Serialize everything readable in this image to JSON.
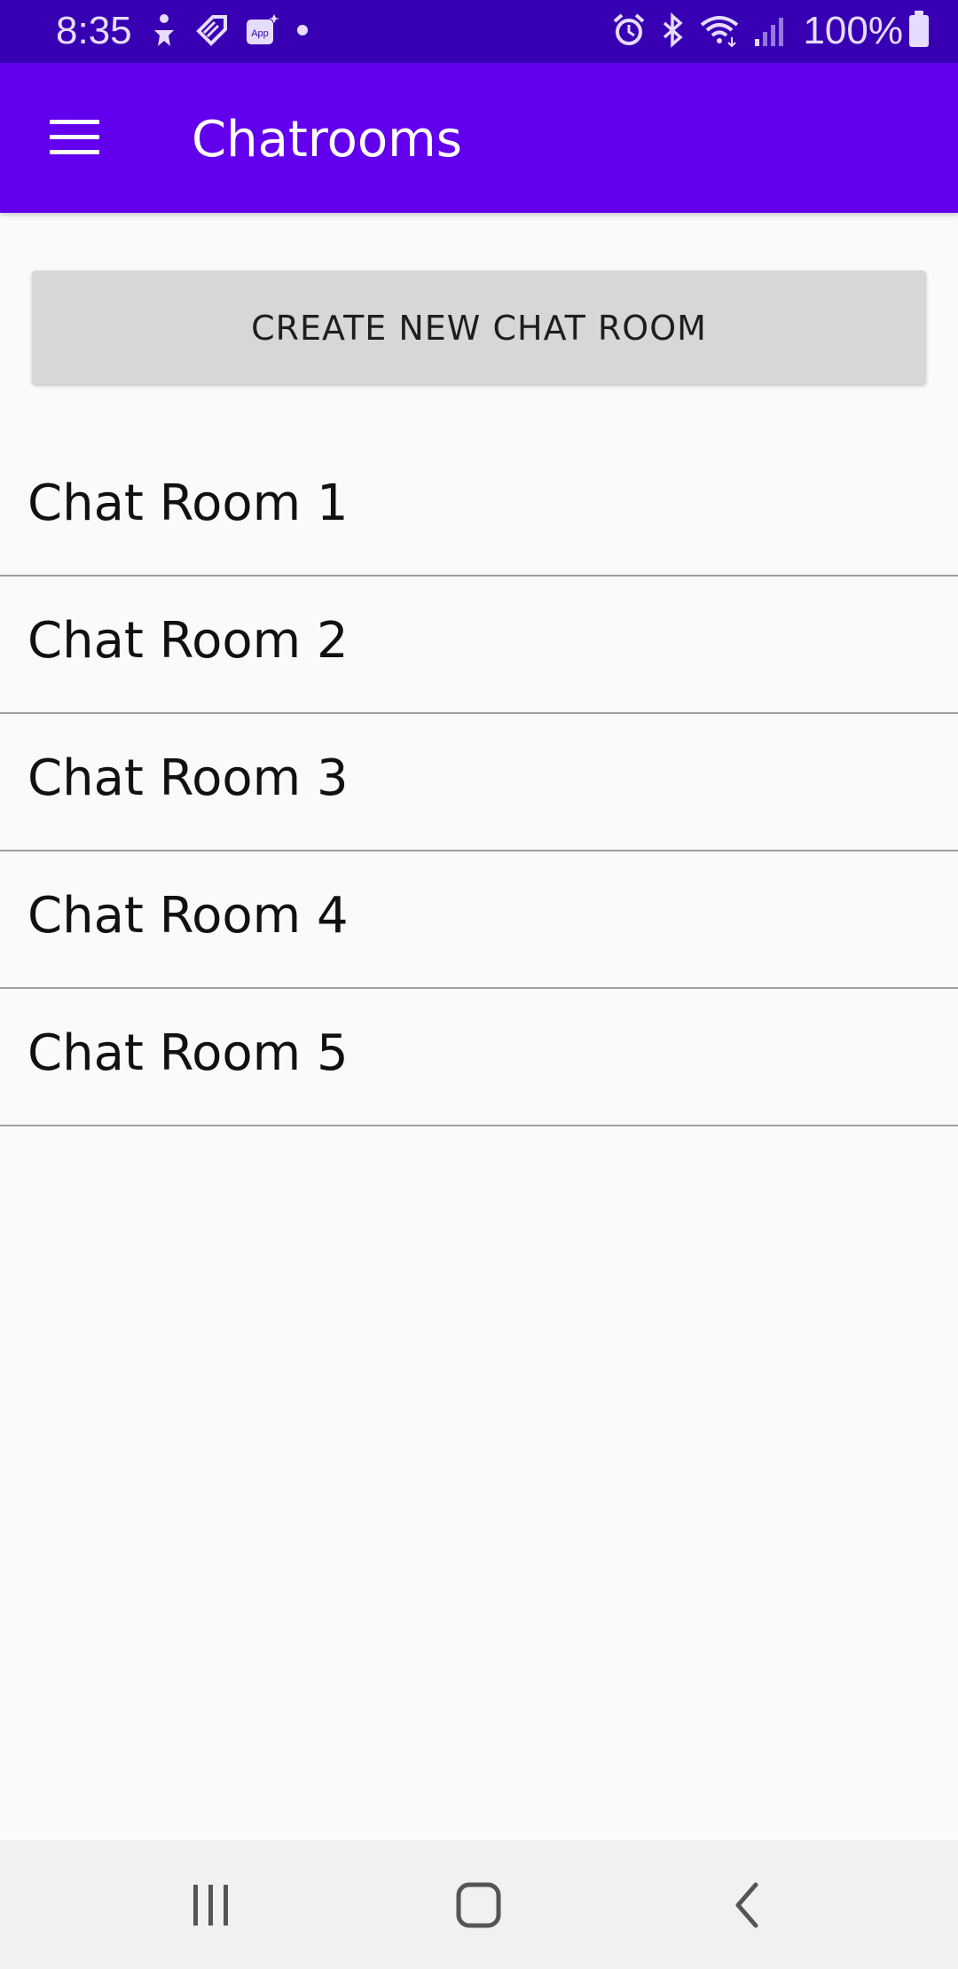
{
  "status_bar": {
    "time": "8:35",
    "battery": "100%",
    "left_icons": [
      "accessibility-icon",
      "tag-icon",
      "app-notification-icon",
      "dot-icon"
    ],
    "right_icons": [
      "alarm-icon",
      "bluetooth-icon",
      "wifi-icon",
      "signal-icon",
      "battery-icon"
    ]
  },
  "app_bar": {
    "title": "Chatrooms",
    "menu_icon": "menu-icon"
  },
  "create_button": {
    "label": "CREATE NEW CHAT ROOM"
  },
  "rooms": [
    {
      "name": "Chat Room 1"
    },
    {
      "name": "Chat Room 2"
    },
    {
      "name": "Chat Room 3"
    },
    {
      "name": "Chat Room 4"
    },
    {
      "name": "Chat Room 5"
    }
  ],
  "nav_bar": {
    "buttons": [
      "recents-icon",
      "home-icon",
      "back-icon"
    ]
  },
  "colors": {
    "status_bar": "#3700b3",
    "app_bar": "#6200ee",
    "background": "#fafafa",
    "button": "#d6d7d7",
    "divider": "#9e9e9e",
    "nav_bar": "#f1f1f1"
  }
}
